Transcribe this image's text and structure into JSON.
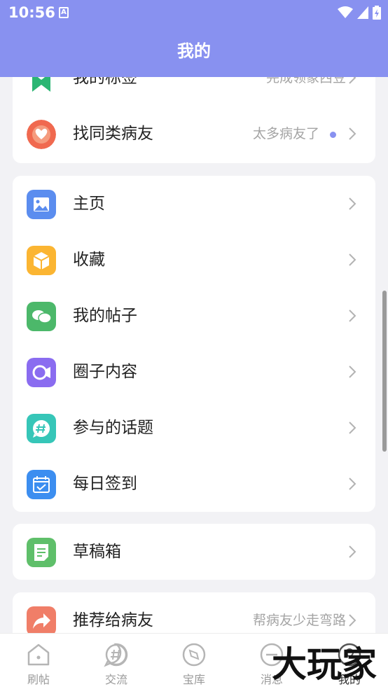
{
  "status_bar": {
    "time": "10:56",
    "notif_icon": "A"
  },
  "header": {
    "title": "我的"
  },
  "sections": {
    "top": {
      "items": [
        {
          "label": "我的标签",
          "hint": "完成领象西豆",
          "icon": "bookmark-badge-icon",
          "color": "#2bb673"
        },
        {
          "label": "找同类病友",
          "hint": "太多病友了",
          "icon": "heart-icon",
          "color": "#f0694f"
        }
      ]
    },
    "features": {
      "items": [
        {
          "label": "主页",
          "icon": "image-icon",
          "color": "#5b8def"
        },
        {
          "label": "收藏",
          "icon": "box-icon",
          "color": "#fbb532"
        },
        {
          "label": "我的帖子",
          "icon": "chat-bubbles-icon",
          "color": "#4cb86a"
        },
        {
          "label": "圈子内容",
          "icon": "camera-circle-icon",
          "color": "#8a6cf0"
        },
        {
          "label": "参与的话题",
          "icon": "hashtag-bubble-icon",
          "color": "#36c6b8"
        },
        {
          "label": "每日签到",
          "icon": "calendar-check-icon",
          "color": "#3c8ef0"
        }
      ]
    },
    "drafts": {
      "items": [
        {
          "label": "草稿箱",
          "icon": "document-edit-icon",
          "color": "#5fbf6a"
        }
      ]
    },
    "share": {
      "items": [
        {
          "label": "推荐给病友",
          "hint": "帮病友少走弯路",
          "icon": "share-arrow-icon",
          "color": "#f07e68"
        }
      ]
    }
  },
  "tabbar": {
    "tabs": [
      {
        "label": "刷帖",
        "icon": "home-icon"
      },
      {
        "label": "交流",
        "icon": "hashtag-chat-icon"
      },
      {
        "label": "宝库",
        "icon": "compass-icon"
      },
      {
        "label": "消息",
        "icon": "message-icon"
      },
      {
        "label": "我的",
        "icon": "profile-icon"
      }
    ]
  },
  "watermark": {
    "text": "大玩家"
  },
  "colors": {
    "accent": "#8891f0",
    "background": "#f2f2f5"
  }
}
